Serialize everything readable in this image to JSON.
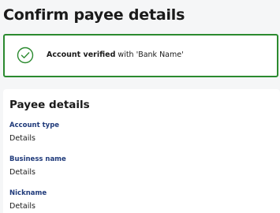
{
  "page": {
    "title": "Confirm payee details"
  },
  "alert": {
    "icon": "check-circle-icon",
    "strong_text": "Account verified",
    "rest_text": " with 'Bank Name'",
    "color": "#2b8a2f"
  },
  "payee": {
    "title": "Payee details",
    "fields": [
      {
        "label": "Account type",
        "value": "Details"
      },
      {
        "label": "Business name",
        "value": "Details"
      },
      {
        "label": "Nickname",
        "value": "Details"
      }
    ]
  },
  "colors": {
    "label": "#1f3a7a",
    "success": "#2b8a2f",
    "background": "#f5f6f7"
  }
}
